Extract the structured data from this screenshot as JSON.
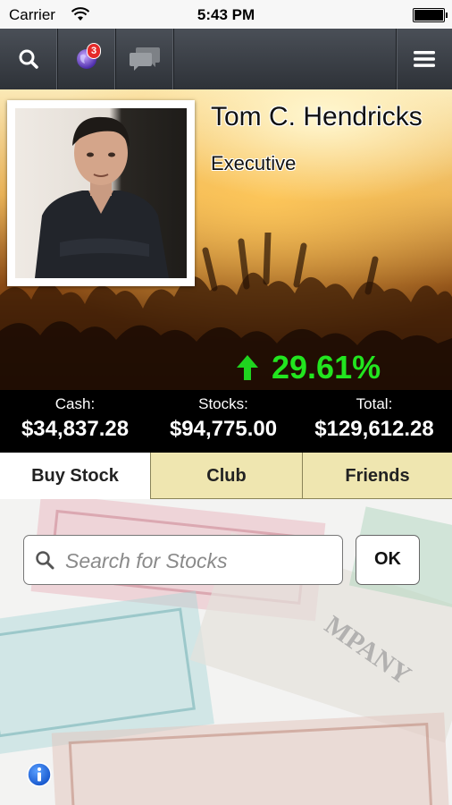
{
  "status_bar": {
    "carrier": "Carrier",
    "time": "5:43 PM"
  },
  "toolbar": {
    "search_icon": "search-icon",
    "globe_icon": "globe-icon",
    "notification_count": "3",
    "chat_icon": "chat-icon",
    "menu_icon": "hamburger-menu-icon"
  },
  "profile": {
    "name": "Tom C. Hendricks",
    "title": "Executive",
    "gain_percent": "29.61%",
    "gain_direction": "up",
    "gain_color": "#22e51f"
  },
  "balances": {
    "cash_label": "Cash:",
    "cash_value": "$34,837.28",
    "stocks_label": "Stocks:",
    "stocks_value": "$94,775.00",
    "total_label": "Total:",
    "total_value": "$129,612.28"
  },
  "tabs": [
    {
      "label": "Buy Stock",
      "active": true
    },
    {
      "label": "Club",
      "active": false
    },
    {
      "label": "Friends",
      "active": false
    }
  ],
  "search": {
    "placeholder": "Search for Stocks",
    "value": "",
    "ok_label": "OK"
  },
  "colors": {
    "tab_inactive": "#efe6b0",
    "toolbar": "#3a3e45",
    "balance_bar": "#000000"
  }
}
